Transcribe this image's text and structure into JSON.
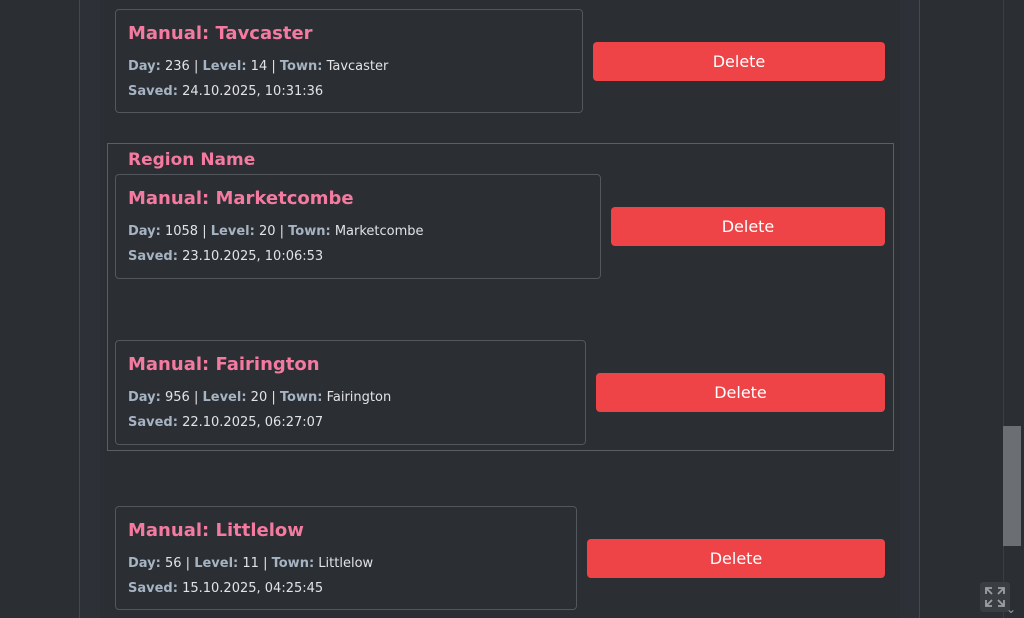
{
  "saves": [
    {
      "title": "Manual: Tavcaster",
      "day_label": "Day:",
      "day": "236",
      "level_label": "Level:",
      "level": "14",
      "town_label": "Town:",
      "town": "Tavcaster",
      "saved_label": "Saved:",
      "saved": "24.10.2025, 10:31:36",
      "delete_label": "Delete"
    },
    {
      "title": "Manual: Marketcombe",
      "day_label": "Day:",
      "day": "1058",
      "level_label": "Level:",
      "level": "20",
      "town_label": "Town:",
      "town": "Marketcombe",
      "saved_label": "Saved:",
      "saved": "23.10.2025, 10:06:53",
      "delete_label": "Delete"
    },
    {
      "title": "Manual: Fairington",
      "day_label": "Day:",
      "day": "956",
      "level_label": "Level:",
      "level": "20",
      "town_label": "Town:",
      "town": "Fairington",
      "saved_label": "Saved:",
      "saved": "22.10.2025, 06:27:07",
      "delete_label": "Delete"
    },
    {
      "title": "Manual: Littlelow",
      "day_label": "Day:",
      "day": "56",
      "level_label": "Level:",
      "level": "11",
      "town_label": "Town:",
      "town": "Littlelow",
      "saved_label": "Saved:",
      "saved": "15.10.2025, 04:25:45",
      "delete_label": "Delete"
    }
  ],
  "region": {
    "name": "Region Name"
  },
  "separator": "|",
  "colors": {
    "accent": "#f47aa0",
    "delete": "#ee4447",
    "background": "#2b2e33"
  },
  "icons": {
    "expand": "expand-icon",
    "scroll_down": "chevron-down-icon"
  }
}
